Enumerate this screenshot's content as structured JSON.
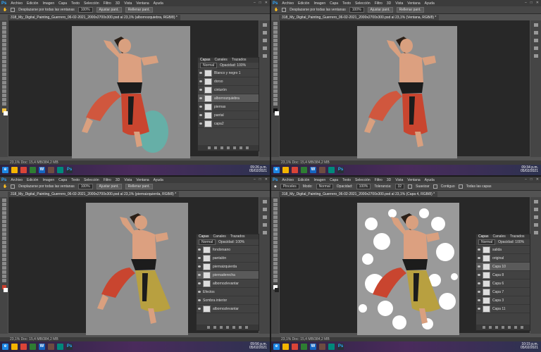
{
  "app": "Ps",
  "menu": [
    "Archivo",
    "Edición",
    "Imagen",
    "Capa",
    "Texto",
    "Selección",
    "Filtro",
    "3D",
    "Vista",
    "Ventana",
    "Ayuda"
  ],
  "options": {
    "scroll_all": "Desplazarse por todas las ventanas",
    "zoom": "100%",
    "fit": "Ajustar pant.",
    "fill": "Rellenar pant.",
    "mode_label": "Pinceles",
    "modo": "Modo:",
    "modo_value": "Normal",
    "opac": "Opacidad:",
    "opac_value": "100%",
    "tol": "Tolerancia:",
    "tol_value": "32",
    "suavizar": "Suavizar",
    "contiguo": "Contiguo",
    "todas": "Todas las capas"
  },
  "quadrants": [
    {
      "doc_title": "318_My_Digital_Painting_Guerrero_06-02-2021_2000x2700x300.psd al 23,1% (albornozquiebra, RGB/8) *",
      "status": "23,1%   Doc: 15,4 MB/384,2 MB",
      "time": "09:26 p.m.",
      "date": "05/02/2021",
      "layers_tabs": [
        "Capas",
        "Canales",
        "Trazados"
      ],
      "blend": "Normal",
      "opacity": "Opacidad: 100%",
      "layers": [
        "Blanco y negro 1",
        "dorso",
        "cinturón",
        "albornozquiebra",
        "piernas",
        "pantal",
        "capa2"
      ]
    },
    {
      "doc_title": "318_My_Digital_Painting_Guerrero_06-02-2021_2000x2700x300.psd al 23,1% (Ventana, RGB/8) *",
      "status": "23,1%   Doc: 15,4 MB/384,2 MB",
      "time": "09:34 p.m.",
      "date": "05/02/2021"
    },
    {
      "doc_title": "318_My_Digital_Painting_Guerrero_06-02-2021_2000x2700x300.psd al 23,1% (piernaizquierda, RGB/8) *",
      "status": "23,1%   Doc: 15,4 MB/384,2 MB",
      "time": "09:56 p.m.",
      "date": "05/02/2021",
      "layers_tabs": [
        "Capas",
        "Canales",
        "Trazados"
      ],
      "blend": "Normal",
      "opacity": "Opacidad: 100%",
      "layers": [
        "fondorsano",
        "pantalón",
        "piernaizquierda",
        "piernaderecha",
        "albornozlevantar",
        "Efectos",
        "Sombra interior",
        "albornozlevantar"
      ],
      "palette": [
        "#2b3042",
        "#4a5468",
        "#6b9c93",
        "#d8e6e0",
        "#a8161c",
        "#c93e2c",
        "#f0a06e"
      ]
    },
    {
      "doc_title": "318_My_Digital_Painting_Guerrero_06-02-2021_2000x2700x300.psd al 23,1% (Capa 4, RGB/8) *",
      "status": "23,1%   Doc: 15,4 MB/384,2 MB",
      "time": "10:15 p.m.",
      "date": "05/02/2021",
      "layers_tabs": [
        "Capas",
        "Canales",
        "Trazados"
      ],
      "blend": "Normal",
      "opacity": "Opacidad: 100%",
      "layers": [
        "salida",
        "original",
        "Capa 10",
        "Capa 8",
        "Capa 6",
        "Capa 7",
        "Capa 3",
        "Capa 11"
      ]
    }
  ]
}
